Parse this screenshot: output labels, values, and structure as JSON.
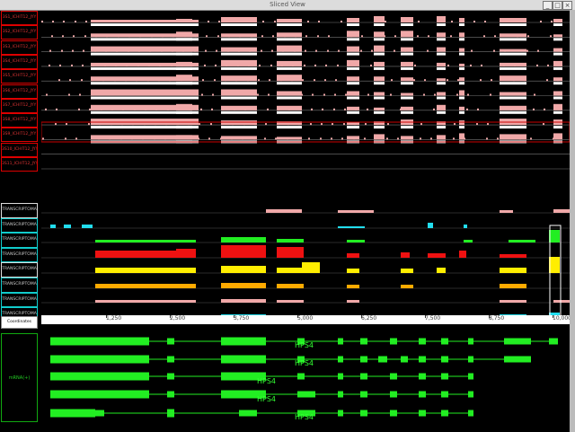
{
  "window": {
    "title": "Sliced View",
    "btn_min": "_",
    "btn_max": "□",
    "btn_close": "×"
  },
  "track_labels": [
    "3S1_ICHIT12_JYY",
    "3S2_ICHIT12_JYY",
    "3S3_ICHIT12_JYY",
    "3S4_ICHIT12_JYY",
    "3S5_ICHIT12_JYY",
    "3S6_ICHIT12_JYY",
    "3S7_ICHIT12_JYY",
    "3S8_ICHIT12_JYY",
    "3S9_ICHIT12_JYY",
    "3S10_ICHIT12_JYY",
    "3S11_ICHIT12_JYY",
    "TRANSCRIPTOMA",
    "TRANSCRIPTOMA",
    "TRANSCRIPTOMA",
    "TRANSCRIPTOMA",
    "TRANSCRIPTOMA",
    "TRANSCRIPTOMA",
    "TRANSCRIPTOMA",
    "TRANSCRIPTOMA"
  ],
  "ruler": {
    "ticks": [
      "1,250",
      "2,500",
      "3,750",
      "5,000",
      "6,250",
      "7,500",
      "8,750",
      "10,000"
    ]
  },
  "coordinates_label": "Coordinates",
  "transcripts_label": "mRNA(+)",
  "gene_labels": [
    "HPS4",
    "HPS4",
    "HPS4",
    "HPS4",
    "HPS4"
  ],
  "colors": {
    "pink": "#f0a8a8",
    "white": "#ffffff",
    "green": "#22ee22",
    "cyan": "#22ddee",
    "red": "#ee1111",
    "yellow": "#ffee00",
    "orange": "#ffaa00"
  }
}
